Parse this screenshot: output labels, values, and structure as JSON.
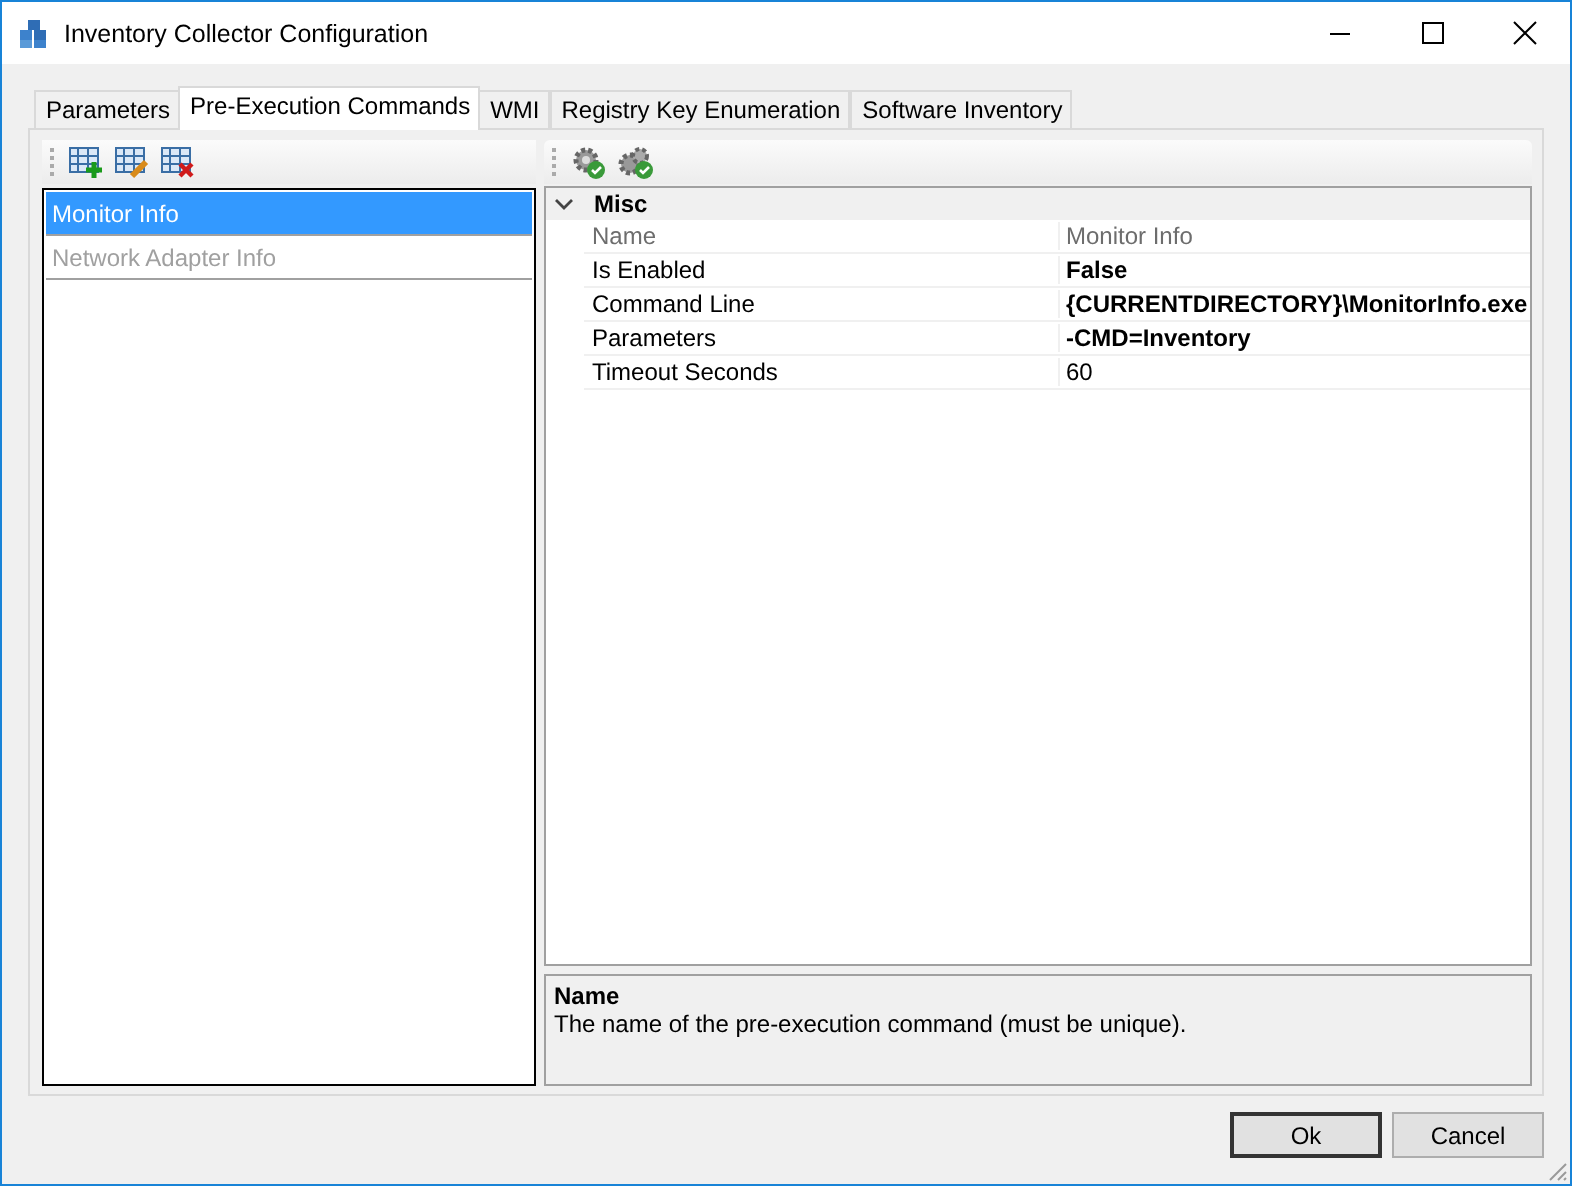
{
  "window": {
    "title": "Inventory Collector Configuration"
  },
  "tabs": [
    {
      "label": "Parameters",
      "selected": false
    },
    {
      "label": "Pre-Execution Commands",
      "selected": true
    },
    {
      "label": "WMI",
      "selected": false
    },
    {
      "label": "Registry Key Enumeration",
      "selected": false
    },
    {
      "label": "Software Inventory",
      "selected": false
    }
  ],
  "commands": [
    {
      "label": "Monitor Info",
      "selected": true,
      "disabled": false
    },
    {
      "label": "Network Adapter Info",
      "selected": false,
      "disabled": true
    }
  ],
  "property_grid": {
    "category": {
      "label": "Misc",
      "expanded": true
    },
    "properties": [
      {
        "name": "Name",
        "value": "Monitor Info",
        "read_only": true,
        "modified": false
      },
      {
        "name": "Is Enabled",
        "value": "False",
        "read_only": false,
        "modified": true
      },
      {
        "name": "Command Line",
        "value": "{CURRENTDIRECTORY}\\MonitorInfo.exe",
        "read_only": false,
        "modified": true
      },
      {
        "name": "Parameters",
        "value": "-CMD=Inventory",
        "read_only": false,
        "modified": true
      },
      {
        "name": "Timeout Seconds",
        "value": "60",
        "read_only": false,
        "modified": false
      }
    ],
    "description": {
      "title": "Name",
      "text": "The name of the pre-execution command (must be unique)."
    }
  },
  "buttons": [
    {
      "label": "Ok",
      "default": true
    },
    {
      "label": "Cancel",
      "default": false
    }
  ]
}
